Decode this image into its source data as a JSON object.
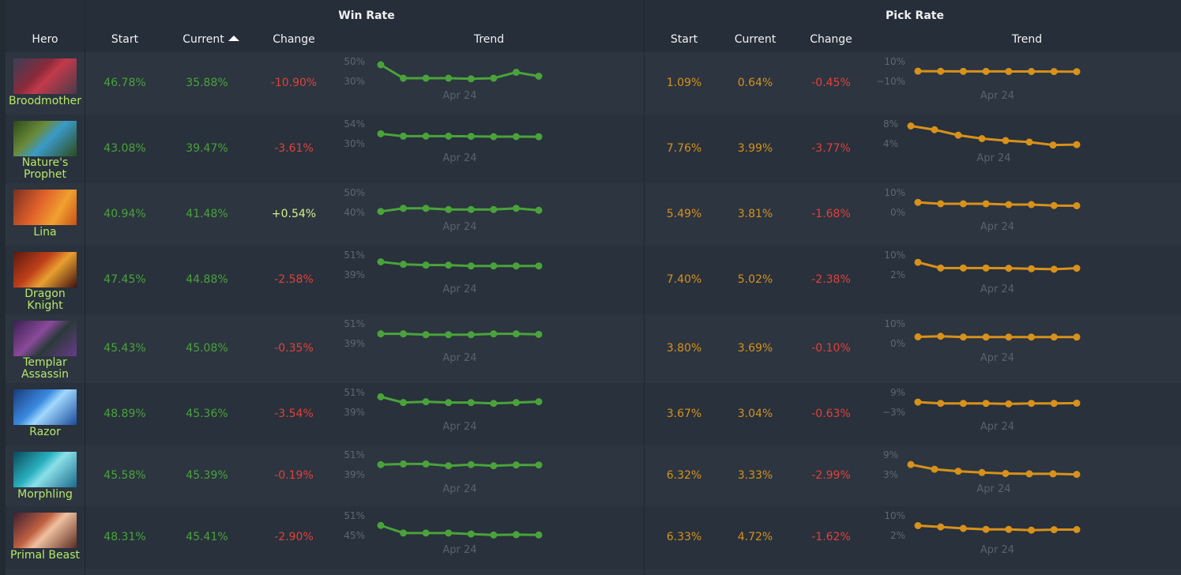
{
  "header": {
    "groups": {
      "win_rate": "Win Rate",
      "pick_rate": "Pick Rate"
    },
    "columns": {
      "hero": "Hero",
      "wr_start": "Start",
      "wr_current": "Current",
      "wr_change": "Change",
      "wr_trend": "Trend",
      "pr_start": "Start",
      "pr_current": "Current",
      "pr_change": "Change",
      "pr_trend": "Trend"
    },
    "sorted_column": "wr_current",
    "sort_direction": "ascending"
  },
  "colors": {
    "win_rate": "#4aa33a",
    "pick_rate": "#d8911a",
    "negative": "#e2403a",
    "positive": "#d6f08a",
    "hero_name": "#b7e868"
  },
  "trend_date_label": "Apr 24",
  "heroes": [
    {
      "name": "Broodmother",
      "portrait": "broodmother-portrait",
      "win_rate": {
        "start": "46.78%",
        "current": "35.88%",
        "change": "-10.90%",
        "change_sign": "neg",
        "trend": {
          "ticks": [
            "50%",
            "30%"
          ],
          "range": [
            30,
            50
          ],
          "values": [
            47.6,
            34.0,
            34.0,
            34.0,
            33.4,
            34.0,
            40.0,
            36.0
          ]
        }
      },
      "pick_rate": {
        "start": "1.09%",
        "current": "0.64%",
        "change": "-0.45%",
        "change_sign": "neg",
        "trend": {
          "ticks": [
            "10%",
            "−10%"
          ],
          "range": [
            -10,
            10
          ],
          "values": [
            1.1,
            1.0,
            0.95,
            0.9,
            0.85,
            0.8,
            0.75,
            0.64
          ]
        }
      }
    },
    {
      "name": "Nature's Prophet",
      "portrait": "natures-prophet-portrait",
      "win_rate": {
        "start": "43.08%",
        "current": "39.47%",
        "change": "-3.61%",
        "change_sign": "neg",
        "trend": {
          "ticks": [
            "54%",
            "30%"
          ],
          "range": [
            30,
            54
          ],
          "values": [
            43.1,
            40.2,
            40.2,
            40.2,
            40.0,
            39.6,
            39.6,
            39.5
          ]
        }
      },
      "pick_rate": {
        "start": "7.76%",
        "current": "3.99%",
        "change": "-3.77%",
        "change_sign": "neg",
        "trend": {
          "ticks": [
            "8%",
            "4%"
          ],
          "range": [
            4,
            8
          ],
          "values": [
            7.76,
            7.0,
            5.9,
            5.2,
            4.8,
            4.5,
            3.9,
            3.99
          ]
        }
      }
    },
    {
      "name": "Lina",
      "portrait": "lina-portrait",
      "win_rate": {
        "start": "40.94%",
        "current": "41.48%",
        "change": "+0.54%",
        "change_sign": "pos",
        "trend": {
          "ticks": [
            "50%",
            "40%"
          ],
          "range": [
            40,
            50
          ],
          "values": [
            40.9,
            42.5,
            42.5,
            41.9,
            41.9,
            41.9,
            42.5,
            41.5
          ]
        }
      },
      "pick_rate": {
        "start": "5.49%",
        "current": "3.81%",
        "change": "-1.68%",
        "change_sign": "neg",
        "trend": {
          "ticks": [
            "10%",
            "0%"
          ],
          "range": [
            0,
            10
          ],
          "values": [
            5.5,
            4.8,
            4.8,
            4.8,
            4.4,
            4.4,
            3.9,
            3.81
          ]
        }
      }
    },
    {
      "name": "Dragon Knight",
      "portrait": "dragon-knight-portrait",
      "win_rate": {
        "start": "47.45%",
        "current": "44.88%",
        "change": "-2.58%",
        "change_sign": "neg",
        "trend": {
          "ticks": [
            "51%",
            "39%"
          ],
          "range": [
            39,
            51
          ],
          "values": [
            47.4,
            45.9,
            45.4,
            45.4,
            44.9,
            44.9,
            44.9,
            44.9
          ]
        }
      },
      "pick_rate": {
        "start": "7.40%",
        "current": "5.02%",
        "change": "-2.38%",
        "change_sign": "neg",
        "trend": {
          "ticks": [
            "10%",
            "2%"
          ],
          "range": [
            2,
            10
          ],
          "values": [
            7.4,
            5.1,
            5.1,
            5.1,
            5.0,
            4.8,
            4.6,
            5.02
          ]
        }
      }
    },
    {
      "name": "Templar Assassin",
      "portrait": "templar-assassin-portrait",
      "win_rate": {
        "start": "45.43%",
        "current": "45.08%",
        "change": "-0.35%",
        "change_sign": "neg",
        "trend": {
          "ticks": [
            "51%",
            "39%"
          ],
          "range": [
            39,
            51
          ],
          "values": [
            45.4,
            45.4,
            44.9,
            44.9,
            44.9,
            45.4,
            45.4,
            45.08
          ]
        }
      },
      "pick_rate": {
        "start": "3.80%",
        "current": "3.69%",
        "change": "-0.10%",
        "change_sign": "neg",
        "trend": {
          "ticks": [
            "10%",
            "0%"
          ],
          "range": [
            0,
            10
          ],
          "values": [
            3.8,
            4.1,
            3.7,
            3.7,
            3.7,
            3.7,
            3.7,
            3.69
          ]
        }
      }
    },
    {
      "name": "Razor",
      "portrait": "razor-portrait",
      "win_rate": {
        "start": "48.89%",
        "current": "45.36%",
        "change": "-3.54%",
        "change_sign": "neg",
        "trend": {
          "ticks": [
            "51%",
            "39%"
          ],
          "range": [
            39,
            51
          ],
          "values": [
            48.9,
            45.4,
            45.9,
            45.4,
            45.4,
            44.9,
            45.4,
            45.9
          ]
        }
      },
      "pick_rate": {
        "start": "3.67%",
        "current": "3.04%",
        "change": "-0.63%",
        "change_sign": "neg",
        "trend": {
          "ticks": [
            "9%",
            "−3%"
          ],
          "range": [
            -3,
            9
          ],
          "values": [
            3.67,
            2.9,
            2.9,
            2.9,
            2.6,
            2.9,
            2.9,
            3.04
          ]
        }
      }
    },
    {
      "name": "Morphling",
      "portrait": "morphling-portrait",
      "win_rate": {
        "start": "45.58%",
        "current": "45.39%",
        "change": "-0.19%",
        "change_sign": "neg",
        "trend": {
          "ticks": [
            "51%",
            "39%"
          ],
          "range": [
            39,
            51
          ],
          "values": [
            45.6,
            46.0,
            46.0,
            44.9,
            45.6,
            44.9,
            45.4,
            45.39
          ]
        }
      },
      "pick_rate": {
        "start": "6.32%",
        "current": "3.33%",
        "change": "-2.99%",
        "change_sign": "neg",
        "trend": {
          "ticks": [
            "9%",
            "3%"
          ],
          "range": [
            3,
            9
          ],
          "values": [
            6.32,
            4.9,
            4.3,
            3.9,
            3.6,
            3.5,
            3.5,
            3.33
          ]
        }
      }
    },
    {
      "name": "Primal Beast",
      "portrait": "primal-beast-portrait",
      "win_rate": {
        "start": "48.31%",
        "current": "45.41%",
        "change": "-2.90%",
        "change_sign": "neg",
        "trend": {
          "ticks": [
            "51%",
            "45%"
          ],
          "range": [
            45,
            51
          ],
          "values": [
            48.3,
            46.0,
            46.0,
            46.0,
            45.7,
            45.4,
            45.5,
            45.41
          ]
        }
      },
      "pick_rate": {
        "start": "6.33%",
        "current": "4.72%",
        "change": "-1.62%",
        "change_sign": "neg",
        "trend": {
          "ticks": [
            "10%",
            "2%"
          ],
          "range": [
            2,
            10
          ],
          "values": [
            6.33,
            5.8,
            5.2,
            4.8,
            4.8,
            4.5,
            4.7,
            4.72
          ]
        }
      }
    }
  ]
}
